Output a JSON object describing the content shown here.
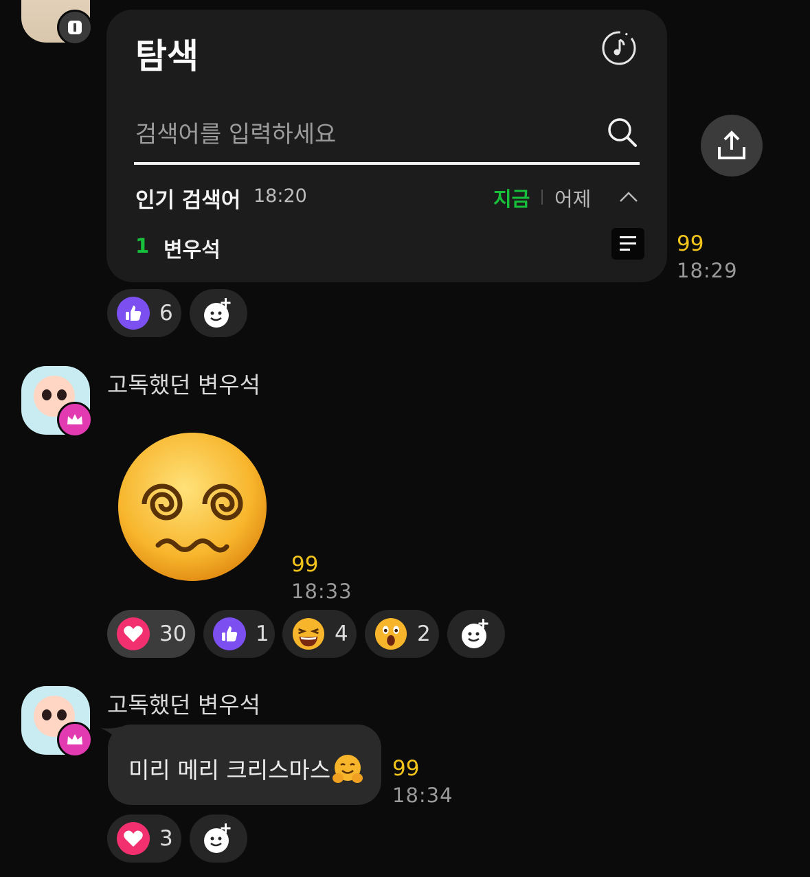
{
  "search_card": {
    "title": "탐색",
    "search_placeholder": "검색어를 입력하세요",
    "popular_title": "인기 검색어",
    "popular_time": "18:20",
    "tab_now": "지금",
    "tab_yesterday": "어제",
    "rank_number": "1",
    "rank_term": "변우석"
  },
  "messages": [
    {
      "count": "99",
      "time": "18:29",
      "reactions": [
        {
          "icon": "thumbs-up",
          "count": "6"
        }
      ]
    },
    {
      "sender": "고독했던 변우석",
      "count": "99",
      "time": "18:33",
      "reactions": [
        {
          "icon": "heart",
          "count": "30"
        },
        {
          "icon": "thumbs-up",
          "count": "1"
        },
        {
          "icon": "laughing-face",
          "count": "4"
        },
        {
          "icon": "surprised-face",
          "count": "2"
        }
      ]
    },
    {
      "sender": "고독했던 변우석",
      "text": "미리 메리 크리스마스",
      "count": "99",
      "time": "18:34",
      "reactions": [
        {
          "icon": "heart",
          "count": "3"
        }
      ]
    }
  ],
  "colors": {
    "accent_green": "#17c03a",
    "count_yellow": "#f3c51c",
    "heart_pink": "#f3306f",
    "crown_badge": "#e23ab1",
    "like_purple": "#7b4ff0"
  }
}
